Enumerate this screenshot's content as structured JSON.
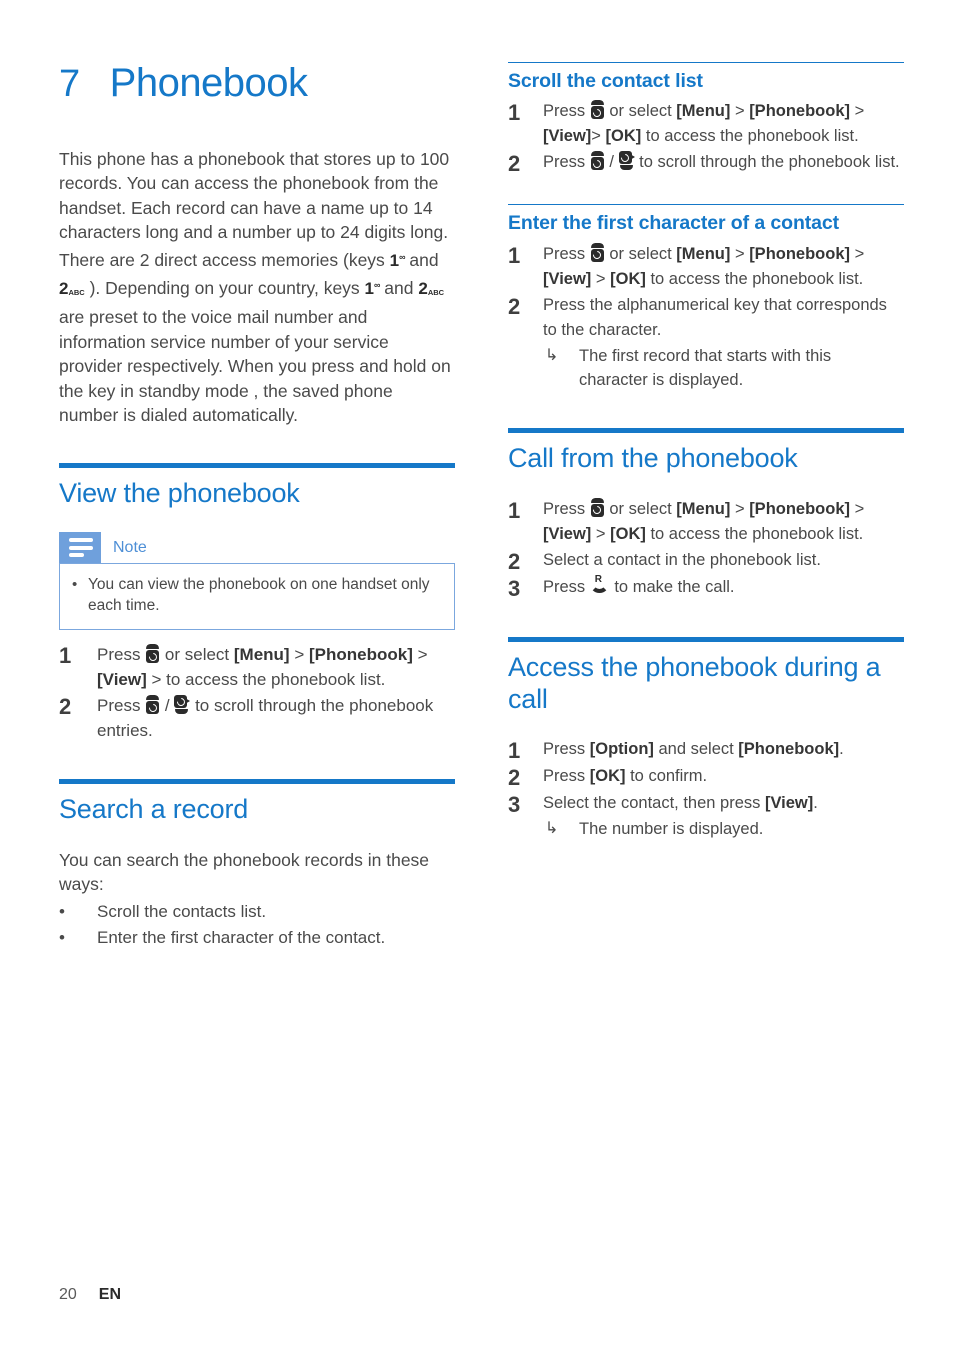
{
  "chapter": {
    "number": "7",
    "title": "Phonebook"
  },
  "intro": {
    "para1_a": "This phone has a phonebook that stores up to 100 records. You can access the phonebook from the handset. Each record can have a name up to 14 characters long and a number up to 24 digits long.",
    "para2_a": "There are 2 direct access memories (keys ",
    "key1_digit": "1",
    "key1_mark": "∞",
    "para2_b": " and ",
    "key2_digit": "2",
    "key2_sub": "ABC",
    "para2_c": " ). Depending on your country, keys ",
    "para2_d": " and ",
    "para2_e": " are preset to the voice mail number and information service number of your service provider respectively. When you press and hold on the key in standby mode , the saved phone number is dialed automatically."
  },
  "left": {
    "view_section": {
      "heading": "View the phonebook",
      "note": {
        "title": "Note",
        "items": [
          "You can view the phonebook on one handset only each time."
        ]
      },
      "steps": [
        {
          "n": "1",
          "parts": [
            {
              "t": "text",
              "v": "Press "
            },
            {
              "t": "icon",
              "v": "scroll-up-phone-icon"
            },
            {
              "t": "text",
              "v": " or select "
            },
            {
              "t": "bold",
              "v": "[Menu]"
            },
            {
              "t": "text",
              "v": " > "
            },
            {
              "t": "bold",
              "v": "[Phonebook]"
            },
            {
              "t": "text",
              "v": " > "
            },
            {
              "t": "bold",
              "v": "[View]"
            },
            {
              "t": "text",
              "v": " > to access the phonebook list."
            }
          ]
        },
        {
          "n": "2",
          "parts": [
            {
              "t": "text",
              "v": "Press "
            },
            {
              "t": "icon",
              "v": "scroll-up-phone-icon"
            },
            {
              "t": "text",
              "v": " / "
            },
            {
              "t": "icon",
              "v": "scroll-down-phone-icon"
            },
            {
              "t": "text",
              "v": " to scroll through the phonebook entries."
            }
          ]
        }
      ]
    },
    "search_section": {
      "heading": "Search a record",
      "intro": "You can search the phonebook records in these ways:",
      "bullets": [
        "Scroll the contacts list.",
        "Enter the first character of the contact."
      ]
    }
  },
  "right": {
    "scroll_section": {
      "heading": "Scroll the contact list",
      "steps": [
        {
          "n": "1",
          "parts": [
            {
              "t": "text",
              "v": "Press "
            },
            {
              "t": "icon",
              "v": "scroll-up-phone-icon"
            },
            {
              "t": "text",
              "v": " or select "
            },
            {
              "t": "bold",
              "v": "[Menu]"
            },
            {
              "t": "text",
              "v": " > "
            },
            {
              "t": "bold",
              "v": "[Phonebook]"
            },
            {
              "t": "text",
              "v": " > "
            },
            {
              "t": "bold",
              "v": "[View]"
            },
            {
              "t": "text",
              "v": "> "
            },
            {
              "t": "bold",
              "v": "[OK]"
            },
            {
              "t": "text",
              "v": " to access the phonebook list."
            }
          ]
        },
        {
          "n": "2",
          "parts": [
            {
              "t": "text",
              "v": "Press "
            },
            {
              "t": "icon",
              "v": "scroll-up-phone-icon"
            },
            {
              "t": "text",
              "v": " / "
            },
            {
              "t": "icon",
              "v": "scroll-down-phone-icon"
            },
            {
              "t": "text",
              "v": " to scroll through the phonebook list."
            }
          ]
        }
      ]
    },
    "enter_section": {
      "heading": "Enter the first character of a contact",
      "steps": [
        {
          "n": "1",
          "parts": [
            {
              "t": "text",
              "v": "Press "
            },
            {
              "t": "icon",
              "v": "scroll-up-phone-icon"
            },
            {
              "t": "text",
              "v": " or select "
            },
            {
              "t": "bold",
              "v": "[Menu]"
            },
            {
              "t": "text",
              "v": " > "
            },
            {
              "t": "bold",
              "v": "[Phonebook]"
            },
            {
              "t": "text",
              "v": " > "
            },
            {
              "t": "bold",
              "v": "[View]"
            },
            {
              "t": "text",
              "v": " > "
            },
            {
              "t": "bold",
              "v": "[OK]"
            },
            {
              "t": "text",
              "v": " to access the phonebook list."
            }
          ]
        },
        {
          "n": "2",
          "parts": [
            {
              "t": "text",
              "v": "Press the alphanumerical key that corresponds to the character."
            }
          ],
          "result": "The first record that starts with this character is displayed."
        }
      ]
    },
    "call_section": {
      "heading": "Call from the phonebook",
      "steps": [
        {
          "n": "1",
          "parts": [
            {
              "t": "text",
              "v": "Press "
            },
            {
              "t": "icon",
              "v": "scroll-up-phone-icon"
            },
            {
              "t": "text",
              "v": " or select "
            },
            {
              "t": "bold",
              "v": "[Menu]"
            },
            {
              "t": "text",
              "v": " > "
            },
            {
              "t": "bold",
              "v": "[Phonebook]"
            },
            {
              "t": "text",
              "v": " > "
            },
            {
              "t": "bold",
              "v": "[View]"
            },
            {
              "t": "text",
              "v": " > "
            },
            {
              "t": "bold",
              "v": "[OK]"
            },
            {
              "t": "text",
              "v": " to access the phonebook list."
            }
          ]
        },
        {
          "n": "2",
          "parts": [
            {
              "t": "text",
              "v": "Select a contact in the phonebook list."
            }
          ]
        },
        {
          "n": "3",
          "parts": [
            {
              "t": "text",
              "v": "Press "
            },
            {
              "t": "icon",
              "v": "call-handset-icon"
            },
            {
              "t": "text",
              "v": " to make the call."
            }
          ]
        }
      ]
    },
    "access_section": {
      "heading": "Access the phonebook during a call",
      "steps": [
        {
          "n": "1",
          "parts": [
            {
              "t": "text",
              "v": "Press "
            },
            {
              "t": "bold",
              "v": "[Option]"
            },
            {
              "t": "text",
              "v": " and select "
            },
            {
              "t": "bold",
              "v": "[Phonebook]"
            },
            {
              "t": "text",
              "v": "."
            }
          ]
        },
        {
          "n": "2",
          "parts": [
            {
              "t": "text",
              "v": "Press "
            },
            {
              "t": "bold",
              "v": "[OK]"
            },
            {
              "t": "text",
              "v": " to confirm."
            }
          ]
        },
        {
          "n": "3",
          "parts": [
            {
              "t": "text",
              "v": "Select the contact, then press "
            },
            {
              "t": "bold",
              "v": "[View]"
            },
            {
              "t": "text",
              "v": "."
            }
          ],
          "result": "The number is displayed."
        }
      ]
    }
  },
  "footer": {
    "page_number": "20",
    "language": "EN"
  },
  "colors": {
    "accent_blue": "#1578C8",
    "note_tab_blue": "#6FA0DC",
    "note_border_blue": "#7BA7DE",
    "body_text": "#4a4a4a"
  },
  "glyphs": {
    "result_arrow": "↳",
    "bullet": "•"
  }
}
